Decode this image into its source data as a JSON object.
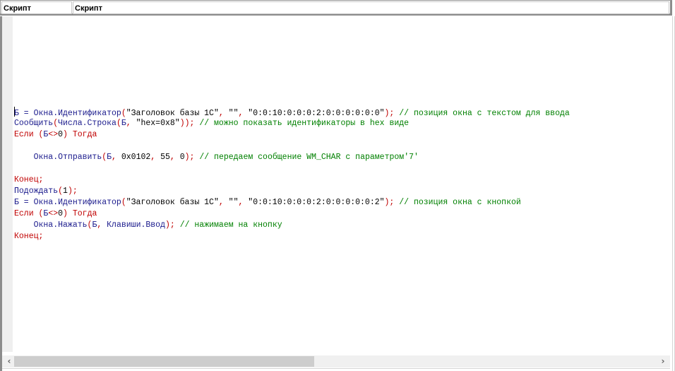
{
  "header": {
    "columns": [
      "Скрипт",
      "Скрипт"
    ]
  },
  "editor": {
    "lines": [
      [
        {
          "t": "id",
          "v": "Б = Окна.Идентификатор"
        },
        {
          "t": "op",
          "v": "("
        },
        {
          "t": "str",
          "v": "\"Заголовок базы 1С\""
        },
        {
          "t": "op",
          "v": ", "
        },
        {
          "t": "str",
          "v": "\"\""
        },
        {
          "t": "op",
          "v": ", "
        },
        {
          "t": "str",
          "v": "\"0:0:10:0:0:0:2:0:0:0:0:0:0\""
        },
        {
          "t": "op",
          "v": "); "
        },
        {
          "t": "cm",
          "v": "// позиция окна с текстом для ввода"
        }
      ],
      [
        {
          "t": "id",
          "v": "Сообщить"
        },
        {
          "t": "op",
          "v": "("
        },
        {
          "t": "id",
          "v": "Числа.Строка"
        },
        {
          "t": "op",
          "v": "("
        },
        {
          "t": "id",
          "v": "Б"
        },
        {
          "t": "op",
          "v": ", "
        },
        {
          "t": "str",
          "v": "\"hex=0x8\""
        },
        {
          "t": "op",
          "v": ")); "
        },
        {
          "t": "cm",
          "v": "// можно показать идентификаторы в hex виде"
        }
      ],
      [
        {
          "t": "kw",
          "v": "Если "
        },
        {
          "t": "op",
          "v": "("
        },
        {
          "t": "id",
          "v": "Б"
        },
        {
          "t": "op",
          "v": "<>"
        },
        {
          "t": "str",
          "v": "0"
        },
        {
          "t": "op",
          "v": ") "
        },
        {
          "t": "kw",
          "v": "Тогда"
        }
      ],
      [],
      [
        {
          "t": "id",
          "v": "    Окна.Отправить"
        },
        {
          "t": "op",
          "v": "("
        },
        {
          "t": "id",
          "v": "Б"
        },
        {
          "t": "op",
          "v": ", "
        },
        {
          "t": "str",
          "v": "0x0102"
        },
        {
          "t": "op",
          "v": ", "
        },
        {
          "t": "str",
          "v": "55"
        },
        {
          "t": "op",
          "v": ", "
        },
        {
          "t": "str",
          "v": "0"
        },
        {
          "t": "op",
          "v": "); "
        },
        {
          "t": "cm",
          "v": "// передаем сообщение WM_CHAR с параметром'7'"
        }
      ],
      [],
      [
        {
          "t": "kw",
          "v": "Конец;"
        }
      ],
      [
        {
          "t": "id",
          "v": "Подождать"
        },
        {
          "t": "op",
          "v": "("
        },
        {
          "t": "str",
          "v": "1"
        },
        {
          "t": "op",
          "v": ");"
        }
      ],
      [
        {
          "t": "id",
          "v": "Б = Окна.Идентификатор"
        },
        {
          "t": "op",
          "v": "("
        },
        {
          "t": "str",
          "v": "\"Заголовок базы 1С\""
        },
        {
          "t": "op",
          "v": ", "
        },
        {
          "t": "str",
          "v": "\"\""
        },
        {
          "t": "op",
          "v": ", "
        },
        {
          "t": "str",
          "v": "\"0:0:10:0:0:0:2:0:0:0:0:0:2\""
        },
        {
          "t": "op",
          "v": "); "
        },
        {
          "t": "cm",
          "v": "// позиция окна с кнопкой"
        }
      ],
      [
        {
          "t": "kw",
          "v": "Если "
        },
        {
          "t": "op",
          "v": "("
        },
        {
          "t": "id",
          "v": "Б"
        },
        {
          "t": "op",
          "v": "<>"
        },
        {
          "t": "str",
          "v": "0"
        },
        {
          "t": "op",
          "v": ") "
        },
        {
          "t": "kw",
          "v": "Тогда"
        }
      ],
      [
        {
          "t": "id",
          "v": "    Окна.Нажать"
        },
        {
          "t": "op",
          "v": "("
        },
        {
          "t": "id",
          "v": "Б"
        },
        {
          "t": "op",
          "v": ", "
        },
        {
          "t": "id",
          "v": "Клавиши.Ввод"
        },
        {
          "t": "op",
          "v": "); "
        },
        {
          "t": "cm",
          "v": "// нажимаем на кнопку"
        }
      ],
      [
        {
          "t": "kw",
          "v": "Конец;"
        }
      ]
    ]
  },
  "scrollbar": {
    "left_icon": "chevron-left-icon",
    "right_icon": "chevron-right-icon",
    "left_glyph": "‹",
    "right_glyph": "›",
    "position_fraction": 0.0,
    "visible_fraction": 0.45
  },
  "colors": {
    "keyword": "#c00000",
    "identifier": "#1a1a8c",
    "string": "#000000",
    "comment": "#008000",
    "gutter": "#efefef"
  }
}
